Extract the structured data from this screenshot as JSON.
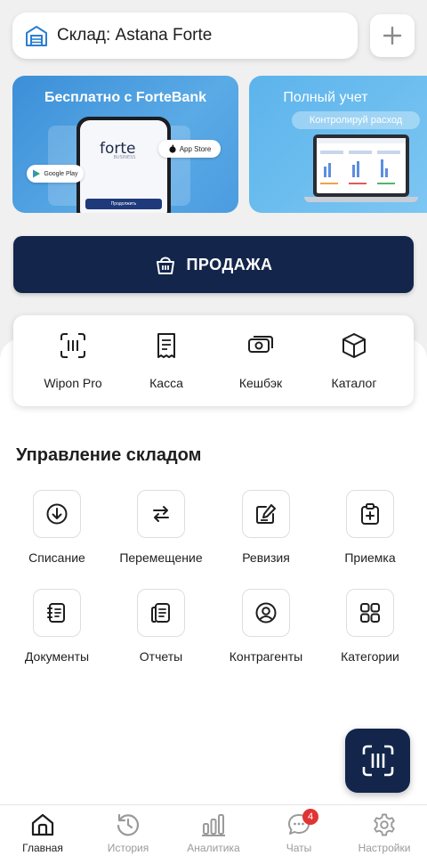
{
  "header": {
    "warehouse_label": "Склад: Astana Forte",
    "add_icon": "plus-icon"
  },
  "banners": [
    {
      "title": "Бесплатно с ForteBank",
      "brand": "forte",
      "brand_sub": "BUSINESS",
      "phone_button": "Продолжить",
      "app_store": "App Store",
      "google_play": "Google Play"
    },
    {
      "title": "Полный учет",
      "subtitle": "Контролируй расход"
    }
  ],
  "sale_button": "ПРОДАЖА",
  "quick_actions": [
    {
      "label": "Wipon Pro",
      "icon": "scanner-icon"
    },
    {
      "label": "Касса",
      "icon": "receipt-icon"
    },
    {
      "label": "Кешбэк",
      "icon": "cashback-icon"
    },
    {
      "label": "Каталог",
      "icon": "box-icon"
    }
  ],
  "warehouse_section": {
    "title": "Управление складом",
    "tiles": [
      {
        "label": "Списание",
        "icon": "download-circle-icon"
      },
      {
        "label": "Перемещение",
        "icon": "transfer-arrows-icon"
      },
      {
        "label": "Ревизия",
        "icon": "edit-document-icon"
      },
      {
        "label": "Приемка",
        "icon": "clipboard-plus-icon"
      },
      {
        "label": "Документы",
        "icon": "notebook-icon"
      },
      {
        "label": "Отчеты",
        "icon": "report-icon"
      },
      {
        "label": "Контрагенты",
        "icon": "user-circle-icon"
      },
      {
        "label": "Категории",
        "icon": "grid-icon"
      }
    ]
  },
  "tabbar": [
    {
      "label": "Главная",
      "icon": "home-icon",
      "active": true
    },
    {
      "label": "История",
      "icon": "history-icon"
    },
    {
      "label": "Аналитика",
      "icon": "analytics-icon"
    },
    {
      "label": "Чаты",
      "icon": "chat-icon",
      "badge": "4"
    },
    {
      "label": "Настройки",
      "icon": "settings-icon"
    }
  ],
  "colors": {
    "primary": "#13254a",
    "accent_blue": "#3b8fd8",
    "badge": "#e03434"
  }
}
